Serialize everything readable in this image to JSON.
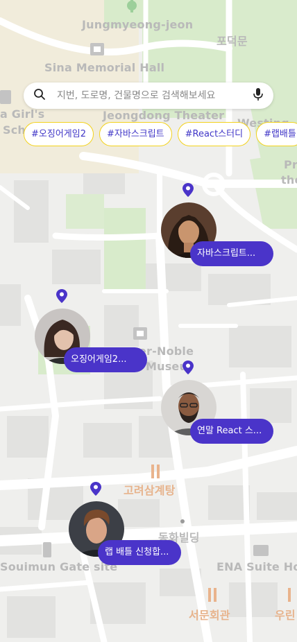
{
  "map": {
    "labels": {
      "jungmyeong": "Jungmyeong-jeon",
      "podeokmun": "포덕문",
      "sina": "Sina Memorial Hall",
      "girls_a": "a Girl's",
      "girls_b": "Sch",
      "jeongdong": "Jeongdong Theater",
      "westing": "Westing",
      "pr_a": "Pr",
      "pr_b": "the",
      "noble_a": "er-Noble",
      "noble_b": "Museu",
      "goryeo": "고려삼계탕",
      "donghwa": "동화빌딩",
      "souimun": "Souimun Gate site",
      "ena": "ENA Suite Hote",
      "seomun": "서문회관",
      "urin": "우린"
    }
  },
  "search": {
    "placeholder": "지번, 도로명, 건물명으로 검색해보세요"
  },
  "chips": [
    {
      "label": "#오징어게임2"
    },
    {
      "label": "#자바스크립트"
    },
    {
      "label": "#React스터디"
    },
    {
      "label": "#랩배틀"
    }
  ],
  "markers": [
    {
      "title": "자바스크립트...",
      "icon": "woman-long-hair-avatar"
    },
    {
      "title": "오징어게임2...",
      "icon": "woman-short-hair-avatar"
    },
    {
      "title": "연말 React 스...",
      "icon": "man-beard-avatar"
    },
    {
      "title": "랩 배틀 신청합...",
      "icon": "young-man-avatar"
    }
  ],
  "colors": {
    "accent": "#4a34c9",
    "chip_border": "#f3d21b",
    "chip_text": "#4036c7",
    "park": "#d6e9c9"
  }
}
